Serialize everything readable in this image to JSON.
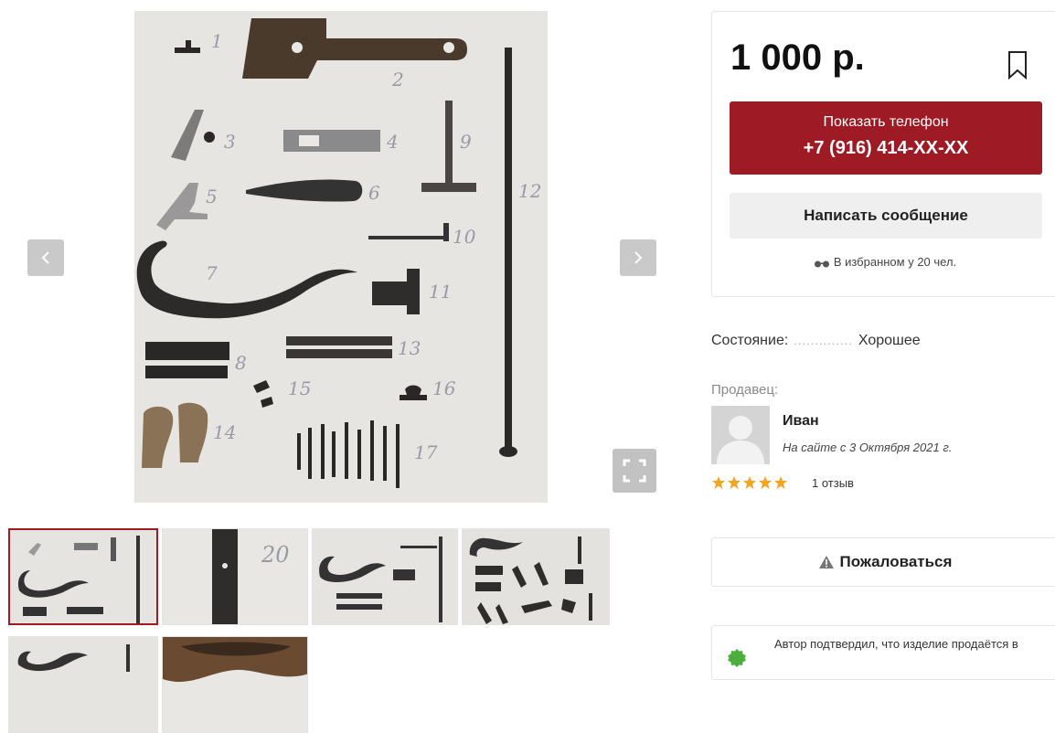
{
  "gallery": {
    "photo_numbers": [
      "1",
      "2",
      "3",
      "4",
      "5",
      "6",
      "7",
      "8",
      "9",
      "10",
      "11",
      "12",
      "13",
      "14",
      "15",
      "16",
      "17"
    ],
    "thumb2_number": "20"
  },
  "listing": {
    "price": "1 000 р.",
    "show_phone_label": "Показать телефон",
    "phone_masked": "+7 (916) 414-XX-XX",
    "message_label": "Написать сообщение",
    "favorites_text": "В избранном у 20 чел."
  },
  "details": {
    "condition_label": "Состояние:",
    "condition_dots": "..............",
    "condition_value": "Хорошее",
    "seller_label": "Продавец:"
  },
  "seller": {
    "name": "Иван",
    "since": "На сайте с 3 Октября 2021 г.",
    "rating": 5,
    "reviews": "1 отзыв"
  },
  "actions": {
    "complain_label": "Пожаловаться"
  },
  "verify": {
    "text": "Автор подтвердил, что изделие продаётся в"
  },
  "colors": {
    "accent": "#9e1b25",
    "star": "#f4a423"
  },
  "icons": [
    "chevron-left-icon",
    "chevron-right-icon",
    "fullscreen-icon",
    "bookmark-icon",
    "glasses-icon",
    "warning-icon",
    "check-badge-icon",
    "user-icon",
    "star-icon"
  ]
}
